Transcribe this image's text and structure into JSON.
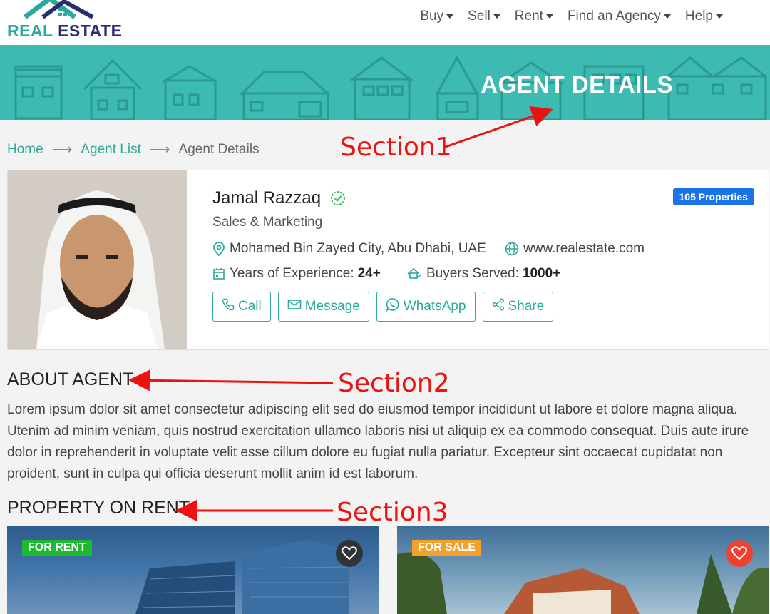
{
  "logo": {
    "word1": "REAL",
    "word2": "ESTATE"
  },
  "nav": {
    "items": [
      {
        "label": "Buy"
      },
      {
        "label": "Sell"
      },
      {
        "label": "Rent"
      },
      {
        "label": "Find an Agency"
      },
      {
        "label": "Help"
      }
    ]
  },
  "banner": {
    "title": "AGENT DETAILS"
  },
  "breadcrumb": {
    "home": "Home",
    "list": "Agent List",
    "current": "Agent Details",
    "separator": "⟶"
  },
  "annotations": {
    "section1": "Section1",
    "section2": "Section2",
    "section3": "Section3"
  },
  "agent": {
    "name": "Jamal Razzaq",
    "role": "Sales & Marketing",
    "properties_badge": "105 Properties",
    "location": "Mohamed Bin Zayed City, Abu Dhabi, UAE",
    "website": "www.realestate.com",
    "experience_label": "Years of Experience:",
    "experience_value": "24+",
    "buyers_label": "Buyers Served:",
    "buyers_value": "1000+",
    "actions": {
      "call": "Call",
      "message": "Message",
      "whatsapp": "WhatsApp",
      "share": "Share"
    }
  },
  "about": {
    "title": "ABOUT AGENT",
    "text": "Lorem ipsum dolor sit amet consectetur adipiscing elit sed do eiusmod tempor incididunt ut labore et dolore magna aliqua. Utenim ad minim veniam, quis nostrud exercitation ullamco laboris nisi ut aliquip ex ea commodo consequat. Duis aute irure dolor in reprehenderit in voluptate velit esse cillum dolore eu fugiat nulla pariatur. Excepteur sint occaecat cupidatat non proident, sunt in culpa qui officia deserunt mollit anim id est laborum."
  },
  "rent_section": {
    "title": "PROPERTY ON RENT",
    "cards": [
      {
        "badge": "FOR RENT"
      },
      {
        "badge": "FOR SALE"
      }
    ]
  },
  "colors": {
    "teal": "#2ba99b",
    "banner": "#3dbbb2",
    "navy": "#2a2d6b",
    "blue_badge": "#1a73e8",
    "annotation_red": "#ee1111"
  }
}
